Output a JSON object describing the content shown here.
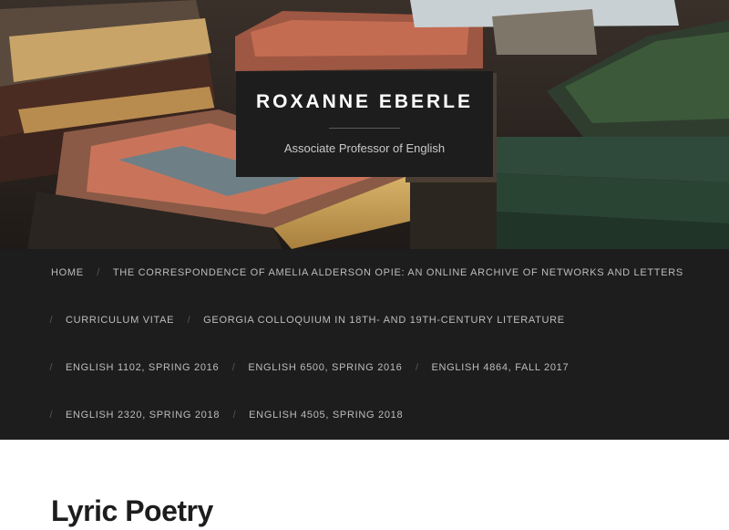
{
  "header": {
    "site_title": "ROXANNE EBERLE",
    "tagline": "Associate Professor of English",
    "background_image": "stack-of-antique-books-icon"
  },
  "nav": {
    "separator": "/",
    "rows": [
      {
        "items": [
          "HOME",
          "THE CORRESPONDENCE OF AMELIA ALDERSON OPIE: AN ONLINE ARCHIVE OF NETWORKS AND LETTERS"
        ]
      },
      {
        "items": [
          "CURRICULUM VITAE",
          "GEORGIA COLLOQUIUM IN 18TH- AND 19TH-CENTURY LITERATURE"
        ]
      },
      {
        "items": [
          "ENGLISH 1102, SPRING 2016",
          "ENGLISH 6500, SPRING 2016",
          "ENGLISH 4864, FALL 2017"
        ]
      },
      {
        "items": [
          "ENGLISH 2320, SPRING 2018",
          "ENGLISH 4505, SPRING 2018"
        ]
      }
    ]
  },
  "main": {
    "post_title": "Lyric Poetry"
  },
  "colors": {
    "nav_bg": "#1d1d1d",
    "nav_text": "#bdbdbd",
    "title_box_bg": "#1d1d1d",
    "heading": "#1d1d1d"
  }
}
